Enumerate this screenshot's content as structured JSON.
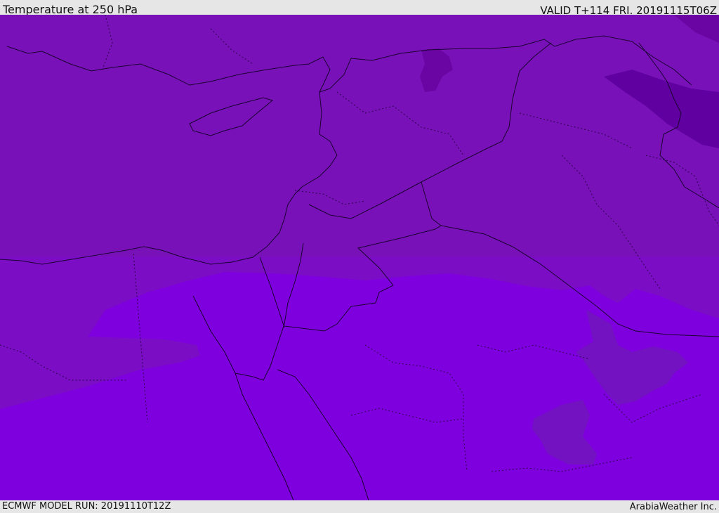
{
  "header": {
    "title": "Temperature at 250 hPa",
    "valid": "VALID T+114 FRI. 20191115T06Z"
  },
  "footer": {
    "model_run": "ECMWF MODEL RUN: 20191110T12Z",
    "credit": "ArabiaWeather Inc."
  },
  "colors": {
    "warm_band": "#7f00de",
    "base": "#7812b8",
    "cool_patch": "#6a05a3",
    "coldest_patch": "#5c0098",
    "border_line": "#1a0030"
  }
}
